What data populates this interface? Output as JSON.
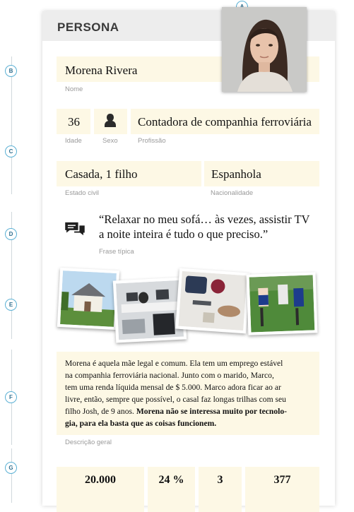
{
  "markers": [
    "A",
    "B",
    "C",
    "D",
    "E",
    "F",
    "G"
  ],
  "header": {
    "title": "PERSONA"
  },
  "name": {
    "value": "Morena Rivera",
    "caption": "Nome"
  },
  "age": {
    "value": "36",
    "caption": "Idade"
  },
  "sex": {
    "caption": "Sexo",
    "icon": "person-silhouette-icon"
  },
  "profession": {
    "value": "Contadora de companhia ferroviária",
    "caption": "Profissão"
  },
  "civil_status": {
    "value": "Casada, 1 filho",
    "caption": "Estado civil"
  },
  "nationality": {
    "value": "Espanhola",
    "caption": "Nacionalidade"
  },
  "quote": {
    "line1": "“Relaxar no meu sofá… às vezes, assistir TV",
    "line2": "a noite inteira é tudo o que preciso.”",
    "caption": "Frase típica",
    "icon": "speech-bubbles-icon"
  },
  "description": {
    "lines": [
      "Morena é aquela mãe legal e comum. Ela tem um emprego estável",
      "na companhia ferroviária nacional. Junto com o marido, Marco,",
      "tem uma renda líquida mensal de $ 5.000. Marco adora ficar ao ar",
      "livre, então, sempre que possível, o casal faz longas trilhas com seu",
      "filho Josh, de 9 anos."
    ],
    "bold_1": "Morena não se interessa muito por tecnolo-",
    "bold_2": "gia, para ela basta que as coisas funcionem.",
    "caption": "Descrição geral"
  },
  "stats": [
    "20.000",
    "24 %",
    "3",
    "377"
  ],
  "colors": {
    "field_bg": "#fdf8e5",
    "marker_ring": "#5ab0d4",
    "header_bg": "#ededed"
  }
}
